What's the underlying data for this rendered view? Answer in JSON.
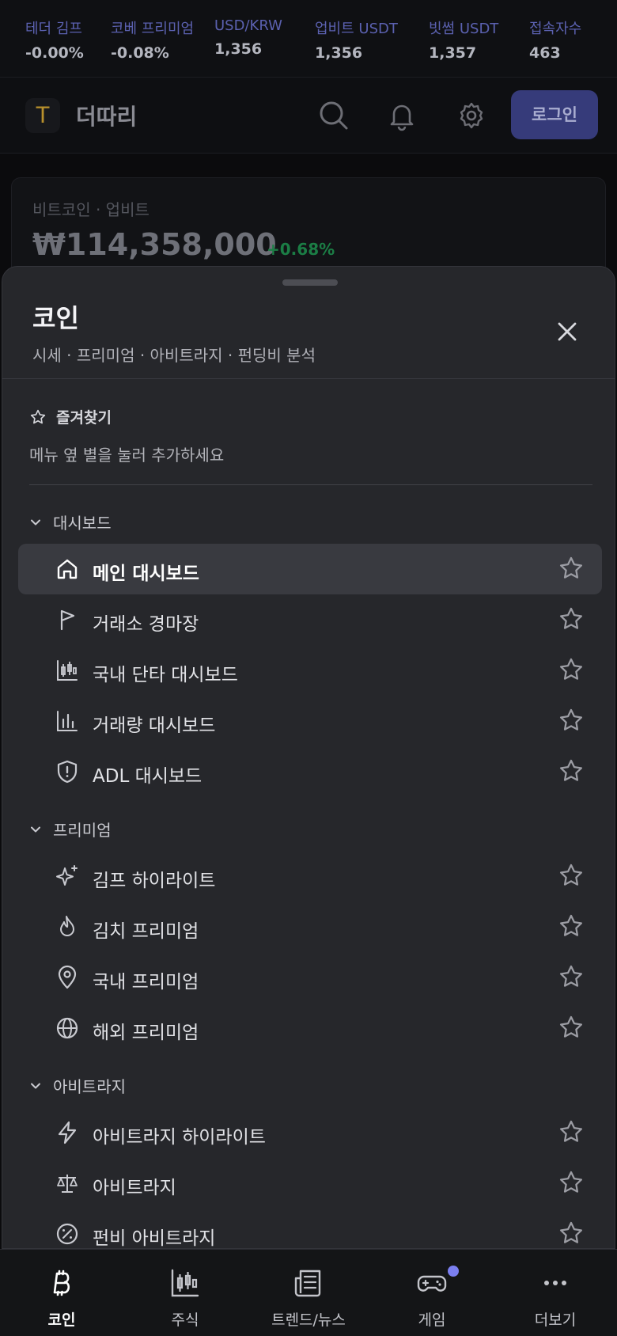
{
  "ticker": [
    {
      "label": "테더 김프",
      "value": "-0.00%"
    },
    {
      "label": "코베 프리미엄",
      "value": "-0.08%"
    },
    {
      "label": "USD/KRW",
      "value": "1,356"
    },
    {
      "label": "업비트 USDT",
      "value": "1,356"
    },
    {
      "label": "빗썸 USDT",
      "value": "1,357"
    },
    {
      "label": "접속자수",
      "value": "463"
    }
  ],
  "header": {
    "logo_letter": "T",
    "brand": "더따리",
    "login_label": "로그인"
  },
  "price_card": {
    "subtitle": "비트코인 · 업비트",
    "price": "₩114,358,000",
    "change": "+0.68%"
  },
  "sheet": {
    "title": "코인",
    "subtitle": "시세 · 프리미엄 · 아비트라지 · 펀딩비 분석",
    "favorites_title": "즐겨찾기",
    "favorites_hint": "메뉴 옆 별을 눌러 추가하세요",
    "sections": [
      {
        "label": "대시보드",
        "items": [
          {
            "label": "메인 대시보드",
            "icon": "home-icon",
            "active": true
          },
          {
            "label": "거래소 경마장",
            "icon": "flag-icon"
          },
          {
            "label": "국내 단타 대시보드",
            "icon": "candlestick-icon"
          },
          {
            "label": "거래량 대시보드",
            "icon": "bar-chart-icon"
          },
          {
            "label": "ADL 대시보드",
            "icon": "shield-alert-icon"
          }
        ]
      },
      {
        "label": "프리미엄",
        "items": [
          {
            "label": "김프 하이라이트",
            "icon": "sparkles-icon"
          },
          {
            "label": "김치 프리미엄",
            "icon": "flame-icon"
          },
          {
            "label": "국내 프리미엄",
            "icon": "map-pin-icon"
          },
          {
            "label": "해외 프리미엄",
            "icon": "globe-icon"
          }
        ]
      },
      {
        "label": "아비트라지",
        "items": [
          {
            "label": "아비트라지 하이라이트",
            "icon": "zap-icon"
          },
          {
            "label": "아비트라지",
            "icon": "scale-icon"
          },
          {
            "label": "펀비 아비트라지",
            "icon": "percent-circle-icon"
          }
        ]
      }
    ]
  },
  "bottom_nav": [
    {
      "label": "코인",
      "icon": "bitcoin-icon",
      "active": true
    },
    {
      "label": "주식",
      "icon": "candlestick-icon"
    },
    {
      "label": "트렌드/뉴스",
      "icon": "newspaper-icon"
    },
    {
      "label": "게임",
      "icon": "gamepad-icon",
      "badge": true
    },
    {
      "label": "더보기",
      "icon": "more-icon"
    }
  ],
  "colors": {
    "accent": "#363b7a",
    "badge": "#7b7ff0",
    "positive": "#1b7d45"
  }
}
